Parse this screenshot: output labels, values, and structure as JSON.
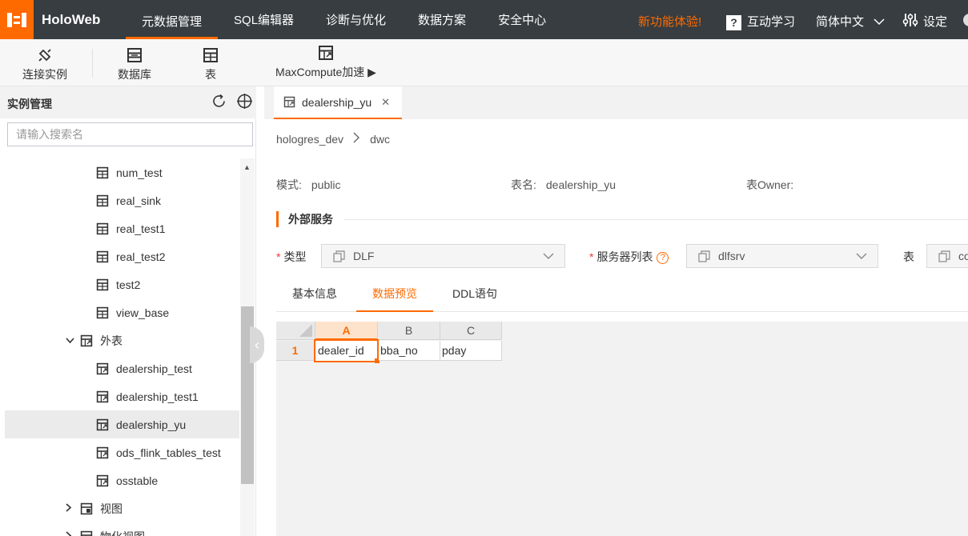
{
  "app": {
    "brand": "HoloWeb"
  },
  "nav": {
    "items": [
      {
        "label": "元数据管理",
        "active": true
      },
      {
        "label": "SQL编辑器",
        "active": false
      },
      {
        "label": "诊断与优化",
        "active": false
      },
      {
        "label": "数据方案",
        "active": false
      },
      {
        "label": "安全中心",
        "active": false
      }
    ],
    "new_feature": "新功能体验!",
    "help_label": "互动学习",
    "language": "简体中文",
    "settings": "设定"
  },
  "toolbar": {
    "connect": "连接实例",
    "database": "数据库",
    "table": "表",
    "maxcompute": "MaxCompute加速 ▶"
  },
  "sidebar": {
    "title": "实例管理",
    "search_placeholder": "请输入搜索名",
    "tree": [
      {
        "label": "num_test",
        "icon": "table-icon",
        "level": 2
      },
      {
        "label": "real_sink",
        "icon": "table-icon",
        "level": 2
      },
      {
        "label": "real_test1",
        "icon": "table-icon",
        "level": 2
      },
      {
        "label": "real_test2",
        "icon": "table-icon",
        "level": 2
      },
      {
        "label": "test2",
        "icon": "table-icon",
        "level": 2
      },
      {
        "label": "view_base",
        "icon": "table-icon",
        "level": 2
      },
      {
        "label": "外表",
        "icon": "foreign-table-icon",
        "level": 1,
        "caret": "expanded"
      },
      {
        "label": "dealership_test",
        "icon": "foreign-table-icon",
        "level": 2
      },
      {
        "label": "dealership_test1",
        "icon": "foreign-table-icon",
        "level": 2
      },
      {
        "label": "dealership_yu",
        "icon": "foreign-table-icon",
        "level": 2,
        "selected": true
      },
      {
        "label": "ods_flink_tables_test",
        "icon": "foreign-table-icon",
        "level": 2
      },
      {
        "label": "osstable",
        "icon": "foreign-table-icon",
        "level": 2
      },
      {
        "label": "视图",
        "icon": "view-icon",
        "level": 1,
        "caret": "collapsed"
      },
      {
        "label": "物化视图",
        "icon": "view-icon",
        "level": 1,
        "caret": "collapsed"
      }
    ]
  },
  "main": {
    "tab_label": "dealership_yu",
    "breadcrumb": [
      "hologres_dev",
      "dwc"
    ],
    "meta": {
      "schema_label": "模式:",
      "schema_value": "public",
      "table_label": "表名:",
      "table_value": "dealership_yu",
      "owner_label": "表Owner:",
      "owner_value": ""
    },
    "section_title": "外部服务",
    "type_label": "类型",
    "type_value": "DLF",
    "server_label": "服务器列表",
    "server_value": "dlfsrv",
    "table_label": "表",
    "table_value": "co",
    "subtabs": [
      {
        "label": "基本信息",
        "active": false
      },
      {
        "label": "数据预览",
        "active": true
      },
      {
        "label": "DDL语句",
        "active": false
      }
    ],
    "grid": {
      "columns": [
        "A",
        "B",
        "C"
      ],
      "row_number": "1",
      "row": [
        "dealer_id",
        "bba_no",
        "pday"
      ]
    }
  },
  "colors": {
    "accent": "#ff6a00",
    "topbar": "#373d41"
  }
}
